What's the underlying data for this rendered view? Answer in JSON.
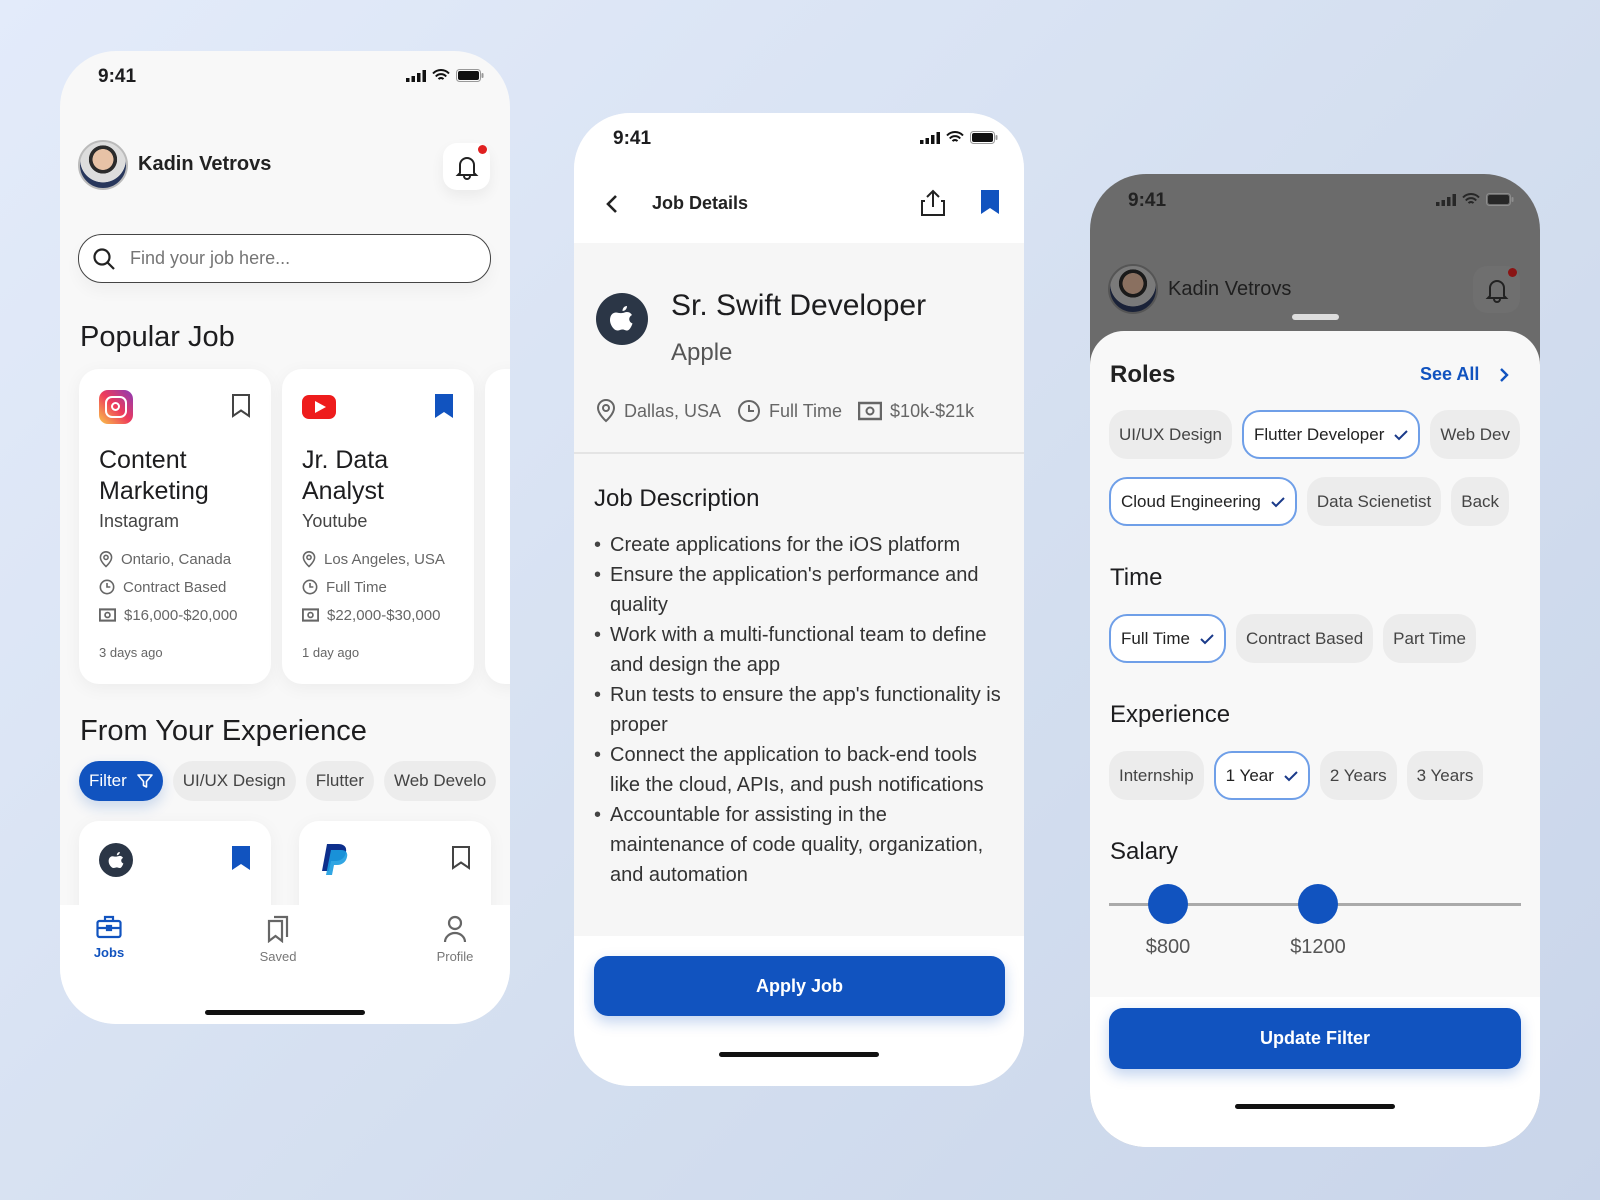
{
  "colors": {
    "accent": "#1153bf",
    "selected_border": "#6f9fe8",
    "notification_dot": "#e02020"
  },
  "status_bar": {
    "time": "9:41"
  },
  "home": {
    "user_name": "Kadin Vetrovs",
    "search": {
      "placeholder": "Find your job here..."
    },
    "popular_title": "Popular Job",
    "popular_jobs": [
      {
        "logo": "instagram-logo",
        "title_line1": "Content",
        "title_line2": "Marketing",
        "company": "Instagram",
        "location": "Ontario, Canada",
        "type": "Contract Based",
        "salary": "$16,000-$20,000",
        "posted": "3 days ago",
        "saved": false
      },
      {
        "logo": "youtube-logo",
        "title_line1": "Jr. Data",
        "title_line2": "Analyst",
        "company": "Youtube",
        "location": "Los Angeles, USA",
        "type": "Full Time",
        "salary": "$22,000-$30,000",
        "posted": "1 day ago",
        "saved": true
      }
    ],
    "experience_title": "From Your Experience",
    "filter_label": "Filter",
    "filter_chips": [
      "UI/UX Design",
      "Flutter",
      "Web Develo"
    ],
    "experience_jobs": [
      {
        "logo": "apple-logo",
        "saved": true
      },
      {
        "logo": "paypal-logo",
        "saved": false
      }
    ],
    "nav": [
      {
        "label": "Jobs",
        "icon": "briefcase-icon",
        "active": true
      },
      {
        "label": "Saved",
        "icon": "bookmarks-icon",
        "active": false
      },
      {
        "label": "Profile",
        "icon": "user-icon",
        "active": false
      }
    ]
  },
  "details": {
    "header_title": "Job Details",
    "job_title": "Sr. Swift Developer",
    "company": "Apple",
    "location": "Dallas, USA",
    "type": "Full Time",
    "salary": "$10k-$21k",
    "description_title": "Job Description",
    "description": [
      "Create applications for the iOS platform",
      "Ensure the application's performance and quality",
      "Work with a multi-functional team to define and design the app",
      "Run tests to ensure the app's functionality is proper",
      "Connect the application to back-end tools like the cloud, APIs, and push notifications",
      "Accountable for assisting in the maintenance of code quality, organization, and automation"
    ],
    "apply_label": "Apply Job"
  },
  "filter": {
    "user_name": "Kadin Vetrovs",
    "roles_title": "Roles",
    "see_all": "See All",
    "roles_row1": [
      {
        "label": "UI/UX Design",
        "selected": false
      },
      {
        "label": "Flutter Developer",
        "selected": true
      },
      {
        "label": "Web Dev",
        "selected": false
      }
    ],
    "roles_row2": [
      {
        "label": "Cloud Engineering",
        "selected": true
      },
      {
        "label": "Data Scienetist",
        "selected": false
      },
      {
        "label": "Back",
        "selected": false
      }
    ],
    "time_title": "Time",
    "time": [
      {
        "label": "Full Time",
        "selected": true
      },
      {
        "label": "Contract Based",
        "selected": false
      },
      {
        "label": "Part Time",
        "selected": false
      }
    ],
    "experience_title": "Experience",
    "experience": [
      {
        "label": "Internship",
        "selected": false
      },
      {
        "label": "1 Year",
        "selected": true
      },
      {
        "label": "2 Years",
        "selected": false
      },
      {
        "label": "3 Years",
        "selected": false
      }
    ],
    "salary_title": "Salary",
    "salary_min": "$800",
    "salary_max": "$1200",
    "update_label": "Update Filter"
  }
}
